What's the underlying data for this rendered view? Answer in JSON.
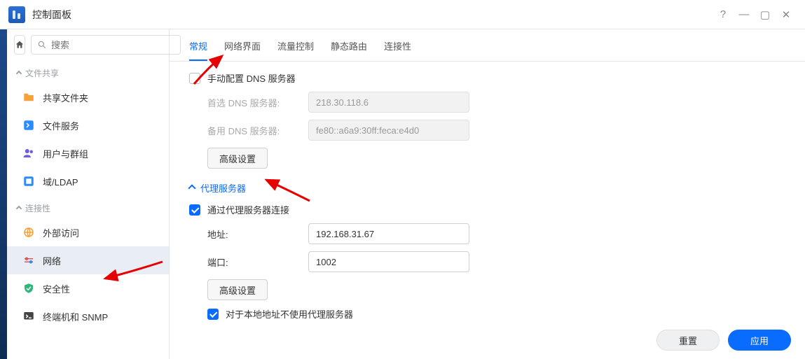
{
  "titlebar": {
    "title": "控制面板"
  },
  "search": {
    "placeholder": "搜索"
  },
  "side_groups": {
    "file_share": {
      "label": "文件共享"
    },
    "connectivity": {
      "label": "连接性"
    }
  },
  "side_items": {
    "shared_folder": {
      "label": "共享文件夹"
    },
    "file_service": {
      "label": "文件服务"
    },
    "users_groups": {
      "label": "用户与群组"
    },
    "domain_ldap": {
      "label": "域/LDAP"
    },
    "ext_access": {
      "label": "外部访问"
    },
    "network": {
      "label": "网络"
    },
    "security": {
      "label": "安全性"
    },
    "terminal_snmp": {
      "label": "终端机和 SNMP"
    }
  },
  "tabs": {
    "general": "常规",
    "interface": "网络界面",
    "traffic": "流量控制",
    "static": "静态路由",
    "conn": "连接性"
  },
  "dns": {
    "manual_label": "手动配置 DNS 服务器",
    "primary_label": "首选 DNS 服务器:",
    "primary_value": "218.30.118.6",
    "secondary_label": "备用 DNS 服务器:",
    "secondary_value": "fe80::a6a9:30ff:feca:e4d0",
    "advanced_btn": "高级设置"
  },
  "proxy": {
    "section_title": "代理服务器",
    "enable_label": "通过代理服务器连接",
    "addr_label": "地址:",
    "addr_value": "192.168.31.67",
    "port_label": "端口:",
    "port_value": "1002",
    "advanced_btn": "高级设置",
    "bypass_label": "对于本地地址不使用代理服务器"
  },
  "footer": {
    "reset": "重置",
    "apply": "应用"
  }
}
